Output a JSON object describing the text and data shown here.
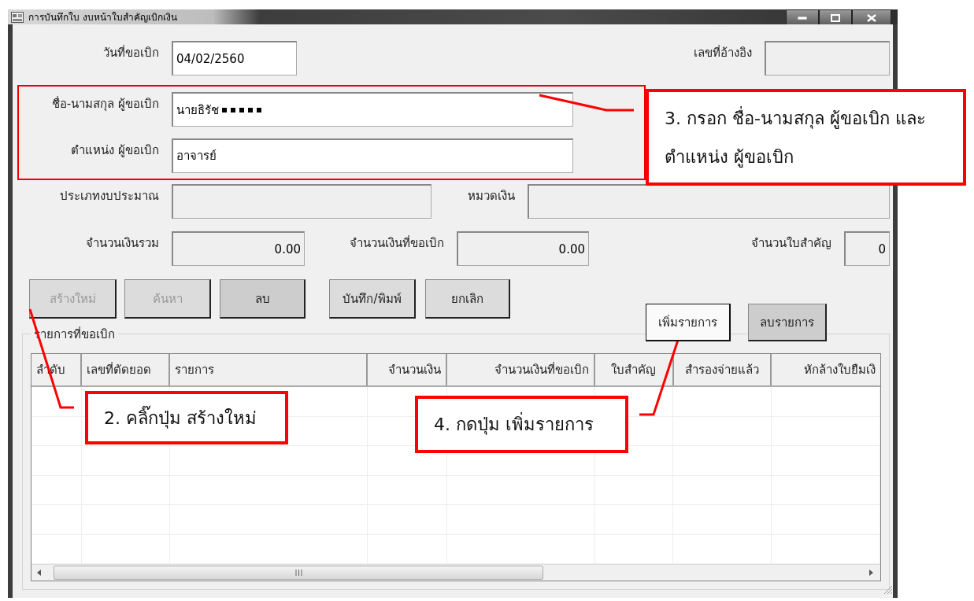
{
  "window": {
    "title": "การบันทึกใบ งบหน้าใบสำคัญเบิกเงิน"
  },
  "form": {
    "request_date": {
      "label": "วันที่ขอเบิก",
      "value": "04/02/2560",
      "readonly": false
    },
    "reference_no": {
      "label": "เลขที่อ้างอิง",
      "readonly": true
    },
    "requester_name": {
      "label": "ชื่อ-นามสกุล ผู้ขอเบิก",
      "value": "นายธิรัช",
      "redacted": true,
      "readonly": false
    },
    "requester_position": {
      "label": "ตำแหน่ง ผู้ขอเบิก",
      "value": "อาจารย์",
      "readonly": false
    },
    "budget_type": {
      "label": "ประเภทงบประมาณ",
      "readonly": true
    },
    "fund_category": {
      "label": "หมวดเงิน",
      "readonly": true
    },
    "total_amount": {
      "label": "จำนวนเงินรวม",
      "value": "0.00",
      "readonly": true
    },
    "requested_amount": {
      "label": "จำนวนเงินที่ขอเบิก",
      "value": "0.00",
      "readonly": true
    },
    "voucher_count": {
      "label": "จำนวนใบสำคัญ",
      "value": "0",
      "readonly": true
    }
  },
  "buttons": [
    {
      "label": "สร้างใหม่",
      "disabled": true
    },
    {
      "label": "ค้นหา",
      "disabled": true
    },
    {
      "label": "ลบ",
      "disabled": false
    },
    {
      "label": "บันทึก/พิมพ์",
      "disabled": false
    },
    {
      "label": "ยกเลิก",
      "disabled": false
    }
  ],
  "items_group": {
    "title": "รายการที่ขอเบิก",
    "buttons": [
      {
        "label": "เพิ่มรายการ",
        "focused": true
      },
      {
        "label": "ลบรายการ",
        "focused": false
      }
    ],
    "table": {
      "columns": [
        "ลำดับ",
        "เลขที่ตัดยอด",
        "รายการ",
        "จำนวนเงิน",
        "จำนวนเงินที่ขอเบิก",
        "ใบสำคัญ",
        "สำรองจ่ายแล้ว",
        "หักล้างใบยืมเงิ"
      ]
    }
  },
  "annotations": [
    {
      "kind": "callout",
      "lines": [
        "3. กรอก ชื่อ-นามสกุล ผู้ขอเบิก และ",
        "ตำแหน่ง ผู้ขอเบิก"
      ]
    },
    {
      "kind": "callout",
      "lines": [
        "2. คลิ๊กปุ่ม สร้างใหม่"
      ]
    },
    {
      "kind": "callout",
      "lines": [
        "4. กดปุ่ม เพิ่มรายการ"
      ]
    }
  ]
}
